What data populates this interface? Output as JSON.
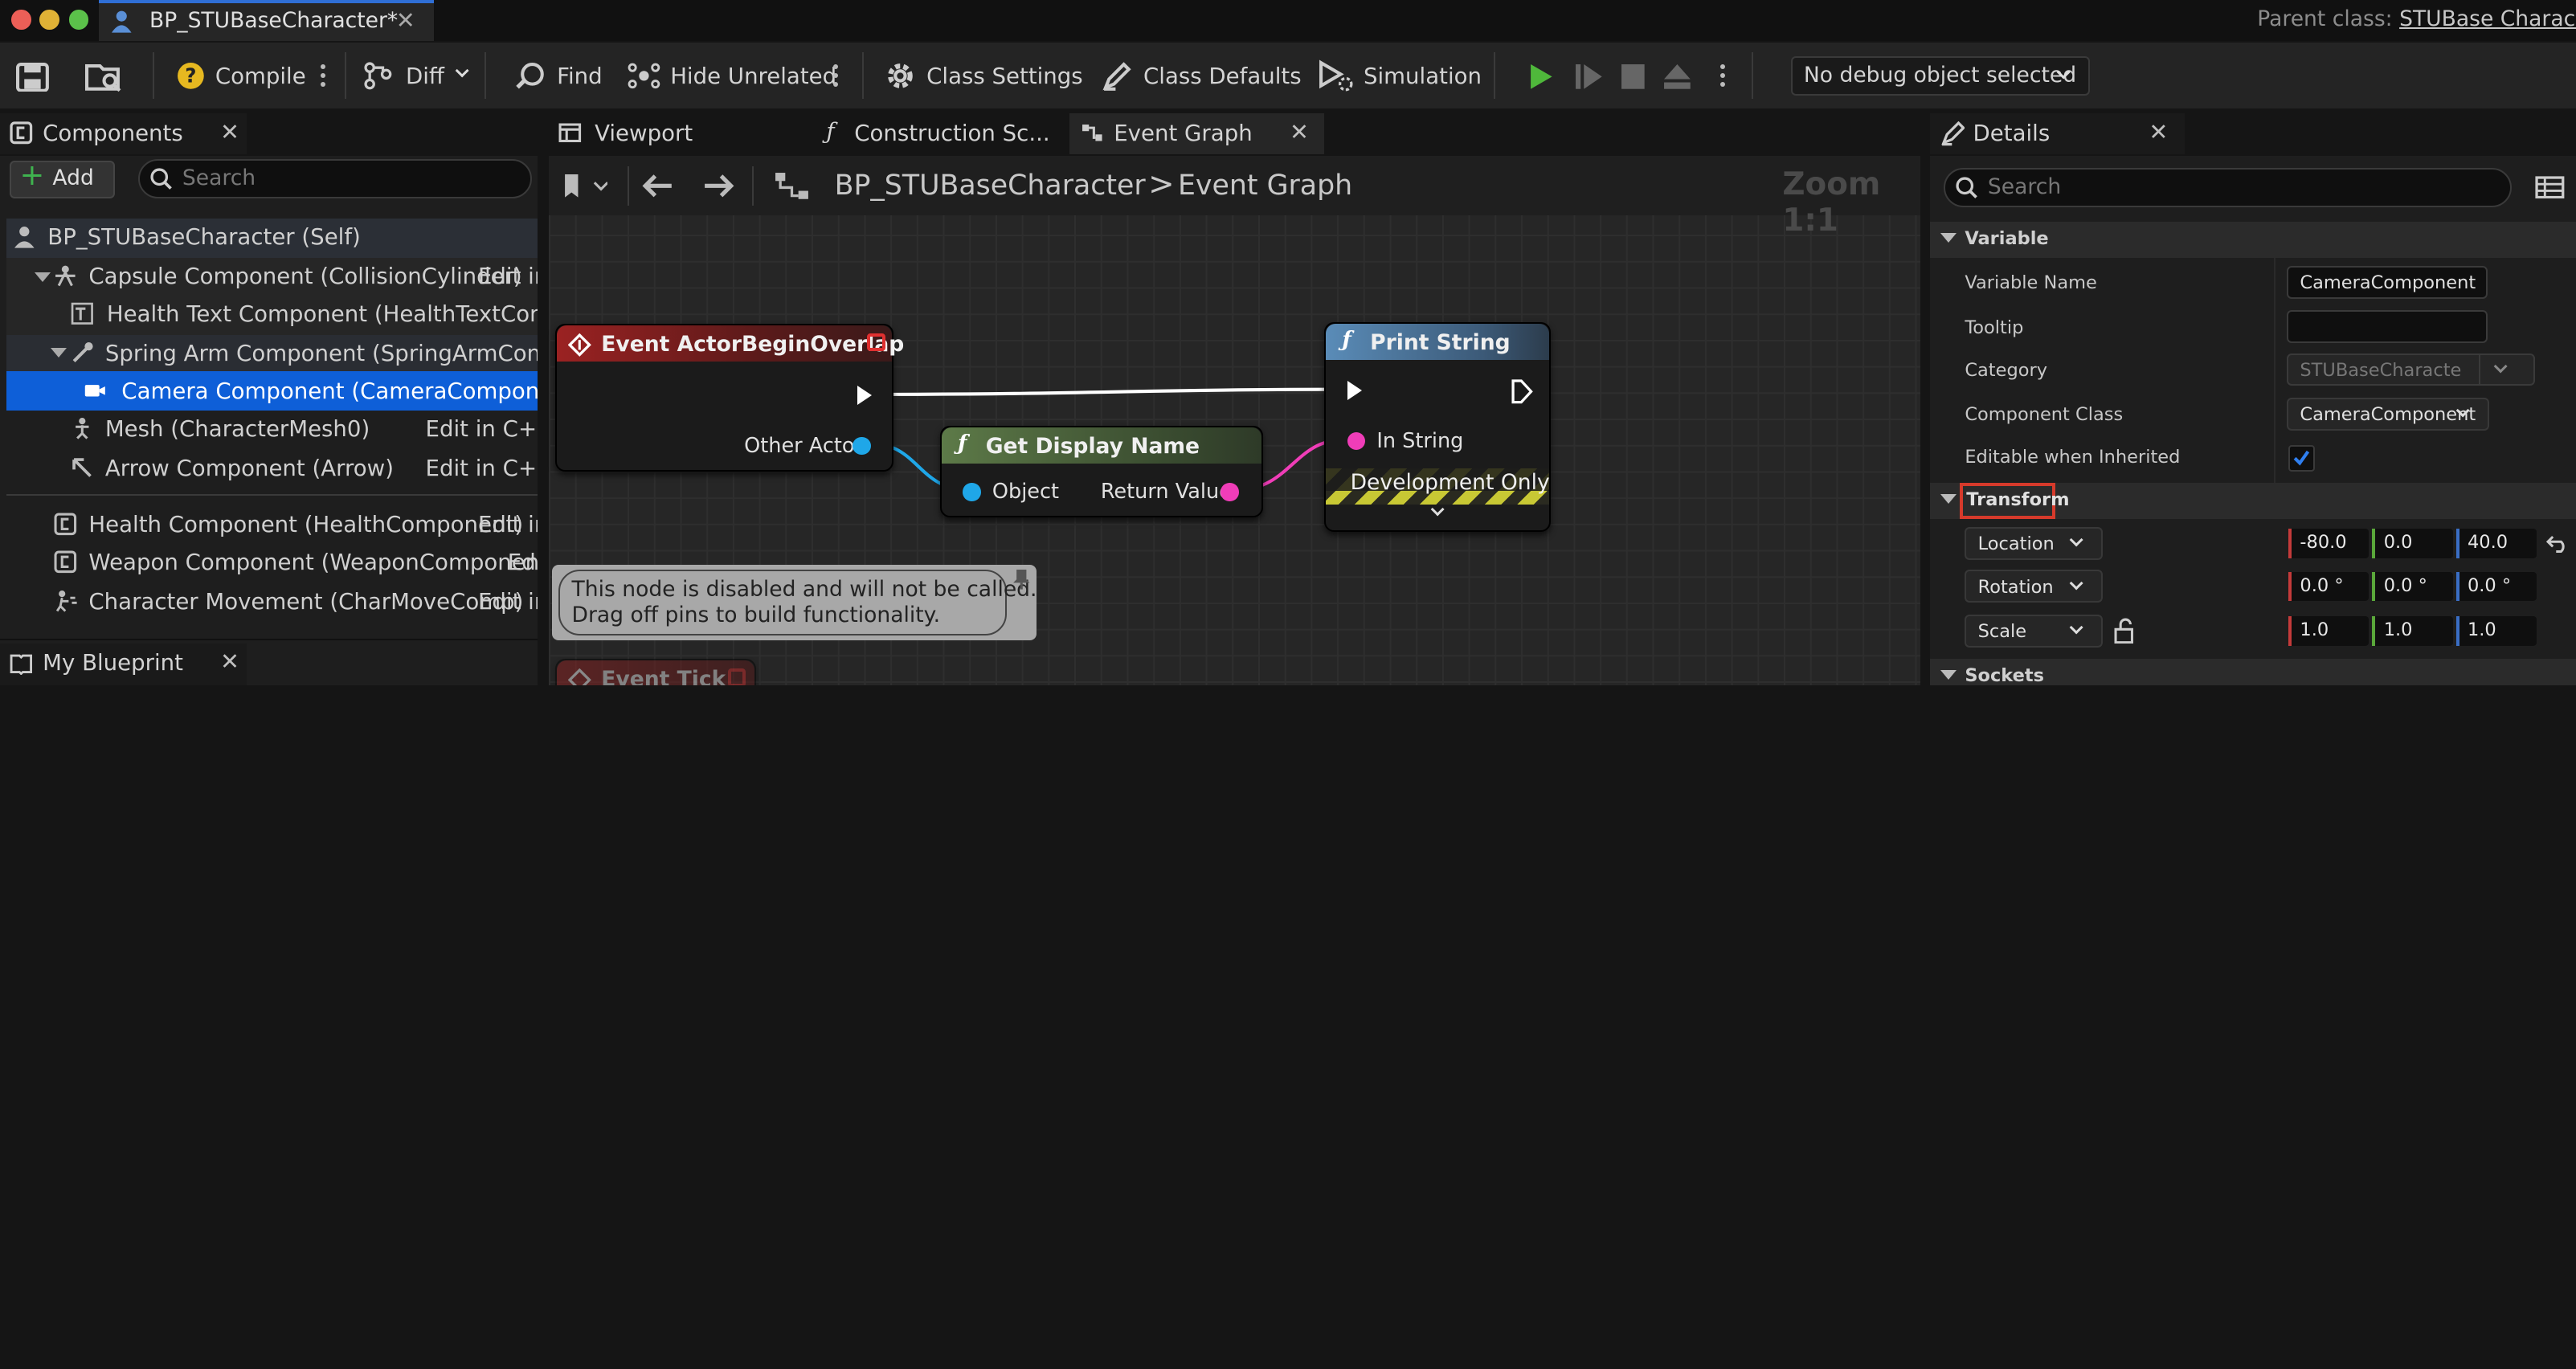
{
  "window": {
    "tab_title": "BP_STUBaseCharacter*",
    "parent_class_label": "Parent class:",
    "parent_class_value": "STUBase Characte"
  },
  "toolbar": {
    "compile": "Compile",
    "diff": "Diff",
    "find": "Find",
    "hide_unrelated": "Hide Unrelated",
    "class_settings": "Class Settings",
    "class_defaults": "Class Defaults",
    "simulation": "Simulation",
    "debug_object": "No debug object selected"
  },
  "components": {
    "tab": "Components",
    "add": "Add",
    "search_placeholder": "Search",
    "rows": [
      {
        "label": "BP_STUBaseCharacter (Self)",
        "edit": ""
      },
      {
        "label": "Capsule Component (CollisionCylinder)",
        "edit": "Edit in"
      },
      {
        "label": "Health Text Component (HealthTextCompone",
        "edit": ""
      },
      {
        "label": "Spring Arm Component (SpringArmCompone",
        "edit": ""
      },
      {
        "label": "Camera Component (CameraComponent)",
        "edit": ""
      },
      {
        "label": "Mesh (CharacterMesh0)",
        "edit": "Edit in C++"
      },
      {
        "label": "Arrow Component (Arrow)",
        "edit": "Edit in C++"
      },
      {
        "label": "Health Component (HealthComponent)",
        "edit": "Edit in"
      },
      {
        "label": "Weapon Component (WeaponComponent)",
        "edit": "Edi"
      },
      {
        "label": "Character Movement (CharMoveComp)",
        "edit": "Edit in"
      }
    ]
  },
  "my_blueprint": {
    "tab": "My Blueprint"
  },
  "editor_tabs": {
    "viewport": "Viewport",
    "construction": "Construction Sc...",
    "event_graph": "Event Graph"
  },
  "graph": {
    "breadcrumb_bp": "BP_STUBaseCharacter",
    "breadcrumb_sep": ">",
    "breadcrumb_graph": "Event Graph",
    "zoom": "Zoom 1:1",
    "node_overlap": {
      "title": "Event ActorBeginOverlap",
      "pin_other_actor": "Other Actor"
    },
    "node_display": {
      "title": "Get Display Name",
      "pin_object": "Object",
      "pin_return": "Return Value"
    },
    "node_print": {
      "title": "Print String",
      "pin_in_string": "In String",
      "dev_only": "Development Only"
    },
    "comment": {
      "line1": "This node is disabled and will not be called.",
      "line2": "Drag off pins to build functionality."
    },
    "node_tick": {
      "title": "Event Tick"
    }
  },
  "details": {
    "tab": "Details",
    "search_placeholder": "Search",
    "section_variable": "Variable",
    "section_transform": "Transform",
    "section_sockets": "Sockets",
    "variable_name_label": "Variable Name",
    "variable_name": "CameraComponent",
    "tooltip_label": "Tooltip",
    "tooltip": "",
    "category_label": "Category",
    "category": "STUBaseCharacte",
    "component_class_label": "Component Class",
    "component_class": "CameraComponent",
    "editable_label": "Editable when Inherited",
    "editable_checked": true,
    "location_label": "Location",
    "location": [
      "-80.0",
      "0.0",
      "40.0"
    ],
    "rotation_label": "Rotation",
    "rotation": [
      "0.0 °",
      "0.0 °",
      "0.0 °"
    ],
    "scale_label": "Scale",
    "scale": [
      "1.0",
      "1.0",
      "1.0"
    ]
  },
  "colors": {
    "accent_blue": "#2f6fd6",
    "highlight_red": "#d63a2b",
    "event_red": "#8a1f1f",
    "func_blue": "#4a7ca8",
    "pure_green": "#4f6e3f",
    "pin_object": "#1fa7e8",
    "pin_string": "#f03db8",
    "axis_x": "#c43a3a",
    "axis_y": "#5aa83a",
    "axis_z": "#3a6ec4"
  }
}
